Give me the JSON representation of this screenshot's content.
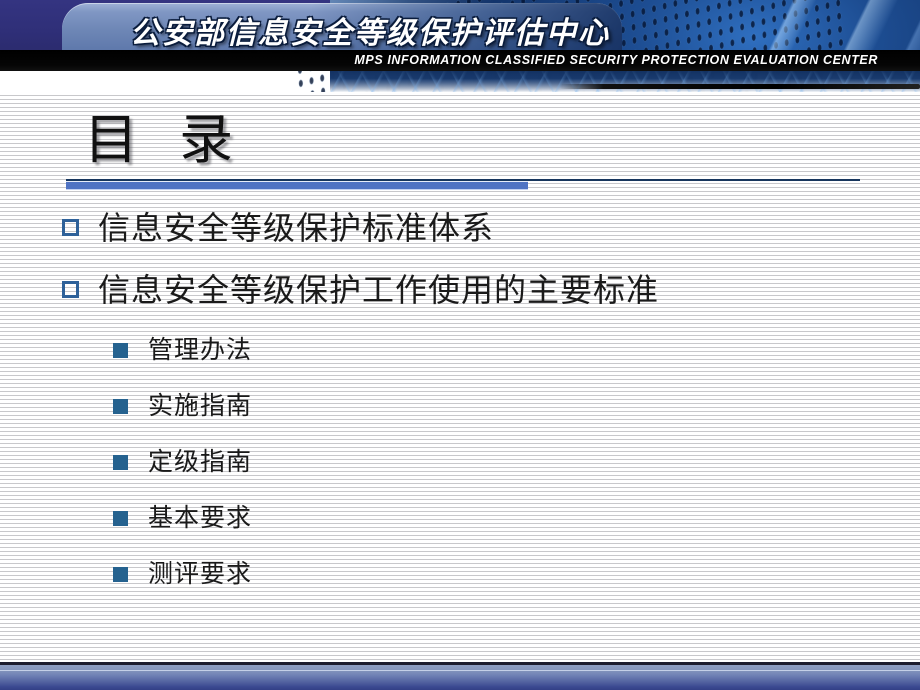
{
  "slide": {
    "title": "目 录",
    "banner": {
      "cn_title": "公安部信息安全等级保护评估中心",
      "en_title": "MPS  INFORMATION  CLASSIFIED  SECURITY  PROTECTION  EVALUATION  CENTER"
    },
    "bullets": {
      "level1": [
        {
          "text": "信息安全等级保护标准体系",
          "marker": "hollow-square"
        },
        {
          "text": "信息安全等级保护工作使用的主要标准",
          "marker": "hollow-square"
        }
      ],
      "level2": [
        {
          "text": "管理办法",
          "marker": "solid-square"
        },
        {
          "text": "实施指南",
          "marker": "solid-square"
        },
        {
          "text": "定级指南",
          "marker": "solid-square"
        },
        {
          "text": "基本要求",
          "marker": "solid-square"
        },
        {
          "text": "测评要求",
          "marker": "solid-square"
        }
      ]
    }
  },
  "colors": {
    "banner_navy": "#333380",
    "banner_plaque": "#7188b8",
    "banner_mesh_blue": "#1d4d92",
    "title_rule_thin": "#17365d",
    "title_rule_thick": "#4f73c3",
    "bullet_hollow_border": "#2e6199",
    "bullet_solid_fill": "#25628f",
    "footer_bar_top": "#8e9ec2",
    "footer_bar_bottom": "#333f86",
    "stripe_line": "#9b9ba0"
  }
}
